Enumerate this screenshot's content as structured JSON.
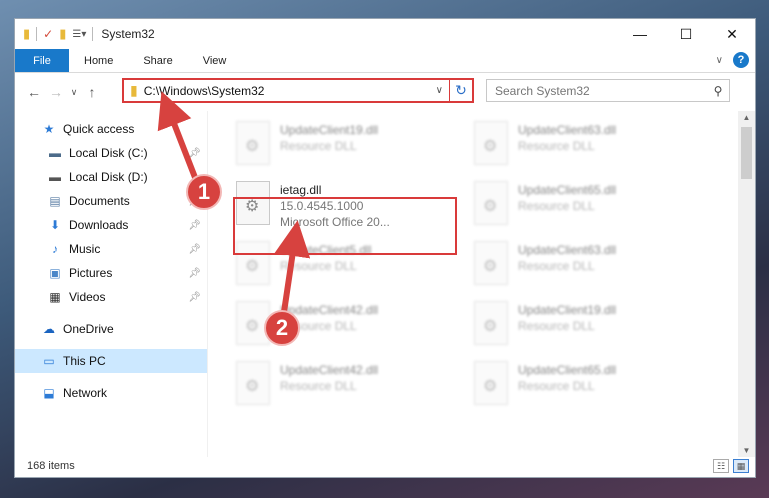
{
  "window": {
    "title": "System32",
    "controls": {
      "minimize": "—",
      "maximize": "☐",
      "close": "✕"
    }
  },
  "ribbon": {
    "tabs": [
      {
        "label": "File",
        "active": true
      },
      {
        "label": "Home"
      },
      {
        "label": "Share"
      },
      {
        "label": "View"
      }
    ],
    "help_label": "?"
  },
  "address": {
    "path": "C:\\Windows\\System32",
    "search_placeholder": "Search System32"
  },
  "sidebar": {
    "quick_access": "Quick access",
    "items": [
      {
        "label": "Local Disk (C:)",
        "icon": "drive-icon",
        "pinned": true
      },
      {
        "label": "Local Disk (D:)",
        "icon": "drive-icon",
        "pinned": false
      },
      {
        "label": "Documents",
        "icon": "documents-icon",
        "pinned": true
      },
      {
        "label": "Downloads",
        "icon": "downloads-icon",
        "pinned": true
      },
      {
        "label": "Music",
        "icon": "music-icon",
        "pinned": true
      },
      {
        "label": "Pictures",
        "icon": "pictures-icon",
        "pinned": true
      },
      {
        "label": "Videos",
        "icon": "videos-icon",
        "pinned": true
      }
    ],
    "onedrive": "OneDrive",
    "this_pc": "This PC",
    "network": "Network"
  },
  "files": {
    "left_column": [
      {
        "name": "UpdateClient19.dll",
        "desc": "Resource DLL"
      },
      {
        "name": "ietag.dll",
        "desc": "15.0.4545.1000",
        "desc2": "Microsoft Office 20..."
      },
      {
        "name": "UpdateClient5.dll",
        "desc": "Resource DLL"
      },
      {
        "name": "UpdateClient42.dll",
        "desc": "Resource DLL"
      },
      {
        "name": "UpdateClient42.dll",
        "desc": "Resource DLL"
      }
    ],
    "right_column": [
      {
        "name": "UpdateClient63.dll",
        "desc": "Resource DLL"
      },
      {
        "name": "UpdateClient65.dll",
        "desc": "Resource DLL"
      },
      {
        "name": "UpdateClient63.dll",
        "desc": "Resource DLL"
      },
      {
        "name": "UpdateClient19.dll",
        "desc": "Resource DLL"
      },
      {
        "name": "UpdateClient65.dll",
        "desc": "Resource DLL"
      }
    ]
  },
  "status": {
    "item_count": "168 items"
  },
  "annotations": {
    "step1": "1",
    "step2": "2",
    "color": "#d93a3a"
  }
}
